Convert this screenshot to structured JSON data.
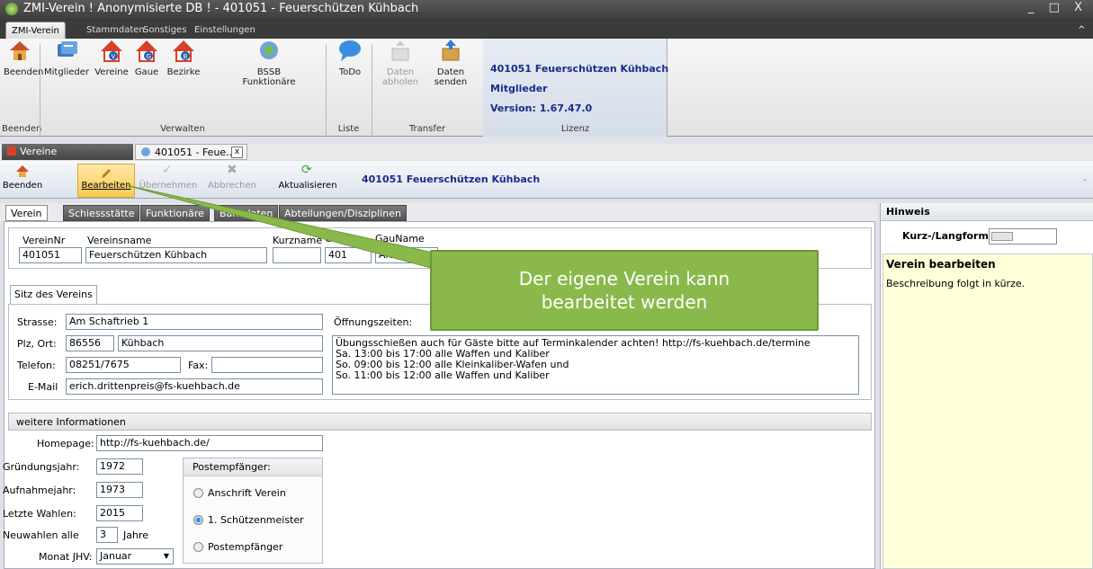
{
  "window": {
    "title": "ZMI-Verein  ! Anonymisierte DB !  - 401051 - Feuerschützen Kühbach",
    "controls": "_ □ X"
  },
  "ribbon_tabs": [
    "ZMI-Verein",
    "Stammdaten",
    "Sonstiges",
    "Einstellungen"
  ],
  "ribbon_collapse": "^",
  "ribbon": {
    "beenden": "Beenden",
    "mitglieder": "Mitglieder",
    "vereine": "Vereine",
    "gaue": "Gaue",
    "bezirke": "Bezirke",
    "bssb1": "BSSB",
    "bssb2": "Funktionäre",
    "todo": "ToDo",
    "daten_abholen1": "Daten",
    "daten_abholen2": "abholen",
    "daten_senden1": "Daten",
    "daten_senden2": "senden",
    "groups": {
      "beenden": "Beenden",
      "verwalten": "Verwalten",
      "liste": "Liste",
      "transfer": "Transfer",
      "lizenz": "Lizenz"
    },
    "lizenz_lines": [
      "401051 Feuerschützen Kühbach",
      "Mitglieder",
      "Version: 1.67.47.0"
    ]
  },
  "doc_tabs": {
    "vereine": "Vereine",
    "current": "401051 - Feue...",
    "close": "x"
  },
  "toolbar": {
    "beenden": "Beenden",
    "bearbeiten": "Bearbeiten",
    "uebernehmen": "Übernehmen",
    "abbrechen": "Abbrechen",
    "aktualisieren": "Aktualisieren",
    "title": "401051  Feuerschützen Kühbach",
    "more": "-"
  },
  "sub_tabs": [
    "Verein",
    "Schiessstätte",
    "Funktionäre",
    "Bankdaten",
    "Abteilungen/Disziplinen"
  ],
  "verein": {
    "h_nr": "VereinNr",
    "h_name": "Vereinsname",
    "h_kurz": "Kurzname",
    "h_gaunr": "GauNr",
    "h_gauname": "GauName",
    "nr": "401051",
    "name": "Feuerschützen Kühbach",
    "kurz": "",
    "gaunr": "401",
    "gauname": "Aichach"
  },
  "sitz": {
    "tab": "Sitz des Vereins",
    "strasse_label": "Strasse:",
    "strasse": "Am Schaftrieb 1",
    "plz_label": "Plz, Ort:",
    "plz": "86556",
    "ort": "Kühbach",
    "telefon_label": "Telefon:",
    "telefon": "08251/7675",
    "fax_label": "Fax:",
    "fax": "",
    "email_label": "E-Mail",
    "email": "erich.drittenpreis@fs-kuehbach.de",
    "oeffnung_label": "Öffnungszeiten:",
    "oeffnung": [
      "Übungsschießen auch für Gäste bitte auf Terminkalender achten! http://fs-kuehbach.de/termine",
      "Sa. 13:00 bis 17:00 alle Waffen und Kaliber",
      "So. 09:00 bis 12:00 alle Kleinkaliber-Wafen und",
      "So. 11:00 bis 12:00 alle Waffen und Kaliber"
    ]
  },
  "weitere": {
    "title": "weitere Informationen",
    "homepage_label": "Homepage:",
    "homepage": "http://fs-kuehbach.de/",
    "gruendung_label": "Gründungsjahr:",
    "gruendung": "1972",
    "aufnahme_label": "Aufnahmejahr:",
    "aufnahme": "1973",
    "wahlen_label": "Letzte Wahlen:",
    "wahlen": "2015",
    "neuwahlen_label": "Neuwahlen alle",
    "neuwahlen": "3",
    "jahre": "Jahre",
    "monat_label": "Monat JHV:",
    "monat": "Januar",
    "post_title": "Postempfänger:",
    "post_options": [
      "Anschrift Verein",
      "1. Schützenmeister",
      "Postempfänger"
    ],
    "post_selected": 1
  },
  "hinweis": {
    "title": "Hinweis",
    "kurz_lang": "Kurz-/Langform",
    "heading": "Verein bearbeiten",
    "text": "Beschreibung folgt in kürze."
  },
  "callout": {
    "line1": "Der eigene Verein kann",
    "line2": "bearbeitet werden"
  },
  "colors": {
    "callout": "#8ab94b",
    "note_bg": "#ffffd8",
    "lizenz_text": "#1c2a8a"
  }
}
